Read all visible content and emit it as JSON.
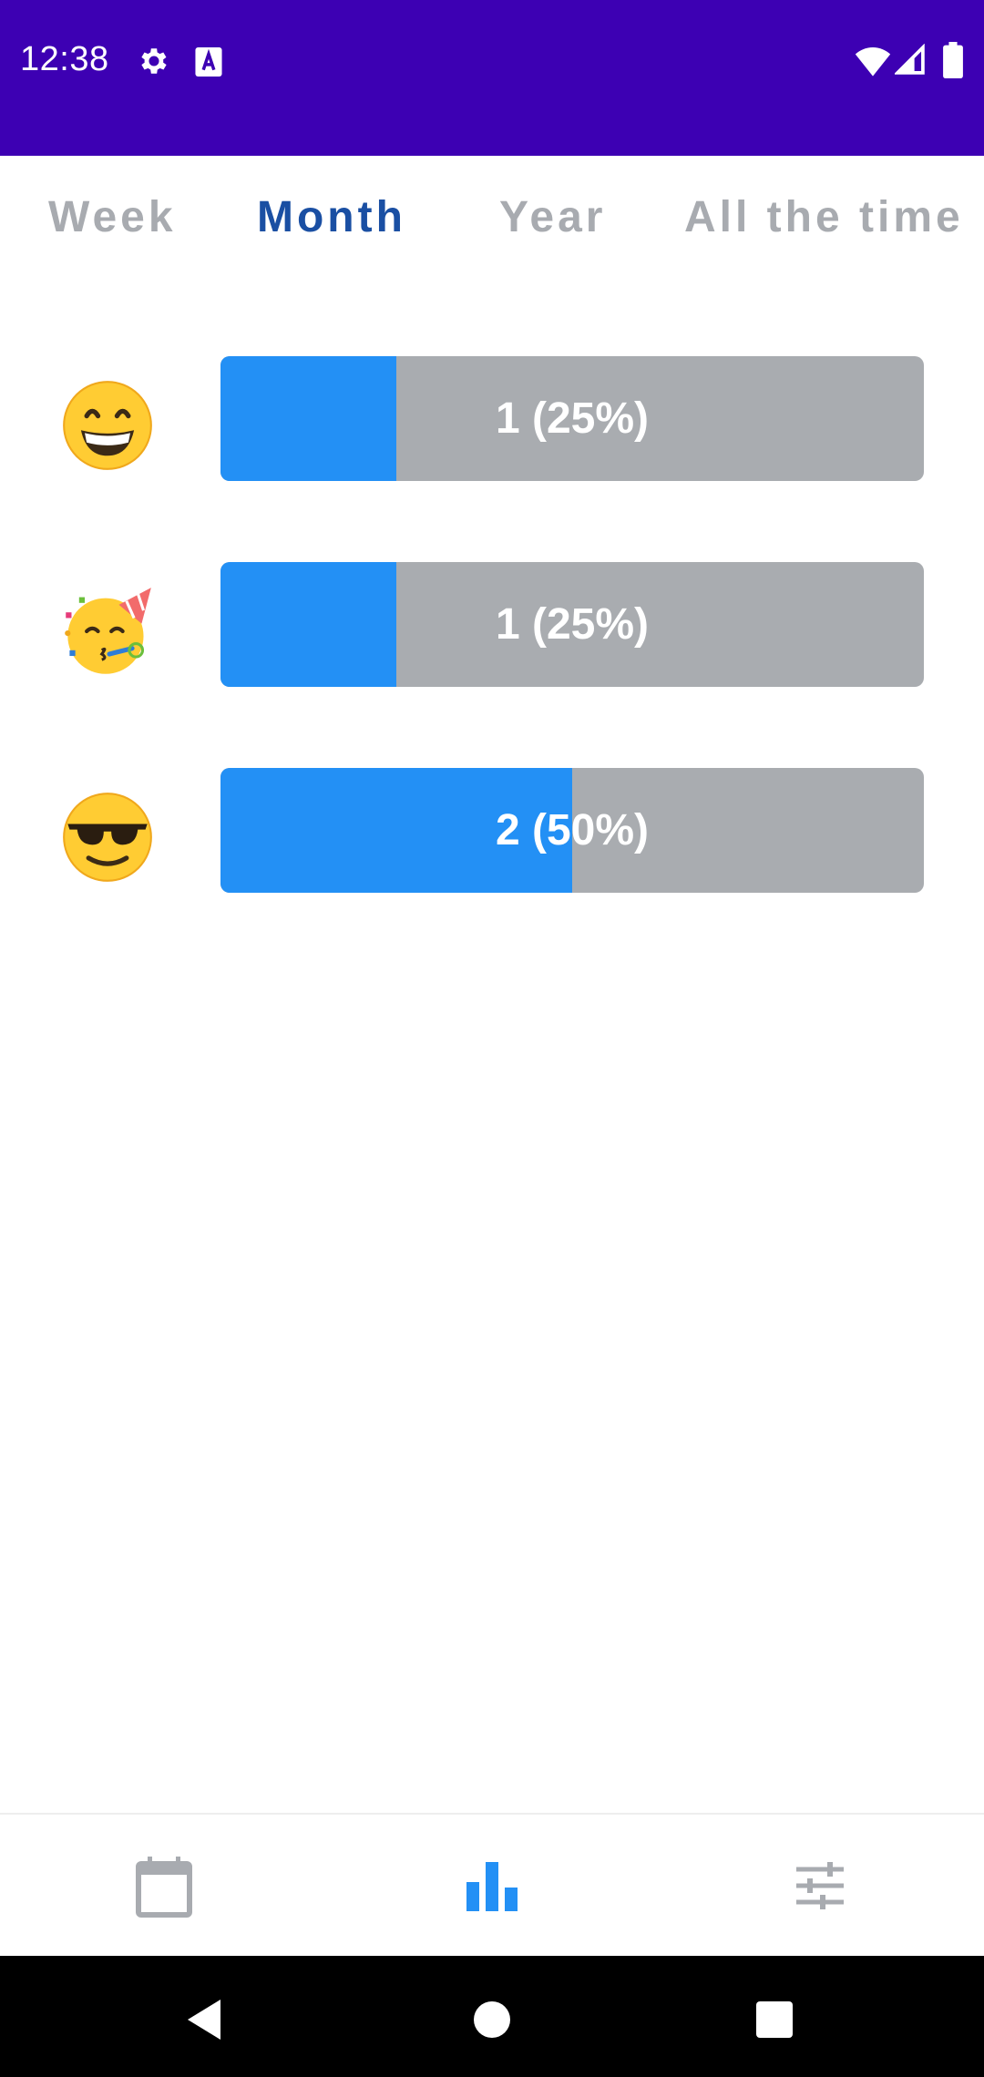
{
  "status_bar": {
    "time": "12:38",
    "icons": [
      "gear-icon",
      "text-a-icon",
      "wifi-icon",
      "signal-icon",
      "battery-icon"
    ],
    "background": "#3d00b3"
  },
  "tabs": [
    {
      "label": "Week",
      "active": false
    },
    {
      "label": "Month",
      "active": true
    },
    {
      "label": "Year",
      "active": false
    },
    {
      "label": "All the time",
      "active": false
    }
  ],
  "colors": {
    "active_tab": "#1a4fa3",
    "inactive_tab": "#a8abb0",
    "bar_fill": "#2390f5",
    "bar_track": "#a9acb0"
  },
  "stats": [
    {
      "emoji": "grinning-face-icon",
      "label": "1 (25%)",
      "fraction": 0.25
    },
    {
      "emoji": "partying-face-icon",
      "label": "1 (25%)",
      "fraction": 0.25
    },
    {
      "emoji": "sunglasses-face-icon",
      "label": "2 (50%)",
      "fraction": 0.5
    }
  ],
  "bottom_nav": [
    {
      "icon": "calendar-icon",
      "active": false
    },
    {
      "icon": "bar-chart-icon",
      "active": true
    },
    {
      "icon": "sliders-icon",
      "active": false
    }
  ],
  "system_nav": [
    "back-icon",
    "home-icon",
    "recents-icon"
  ]
}
